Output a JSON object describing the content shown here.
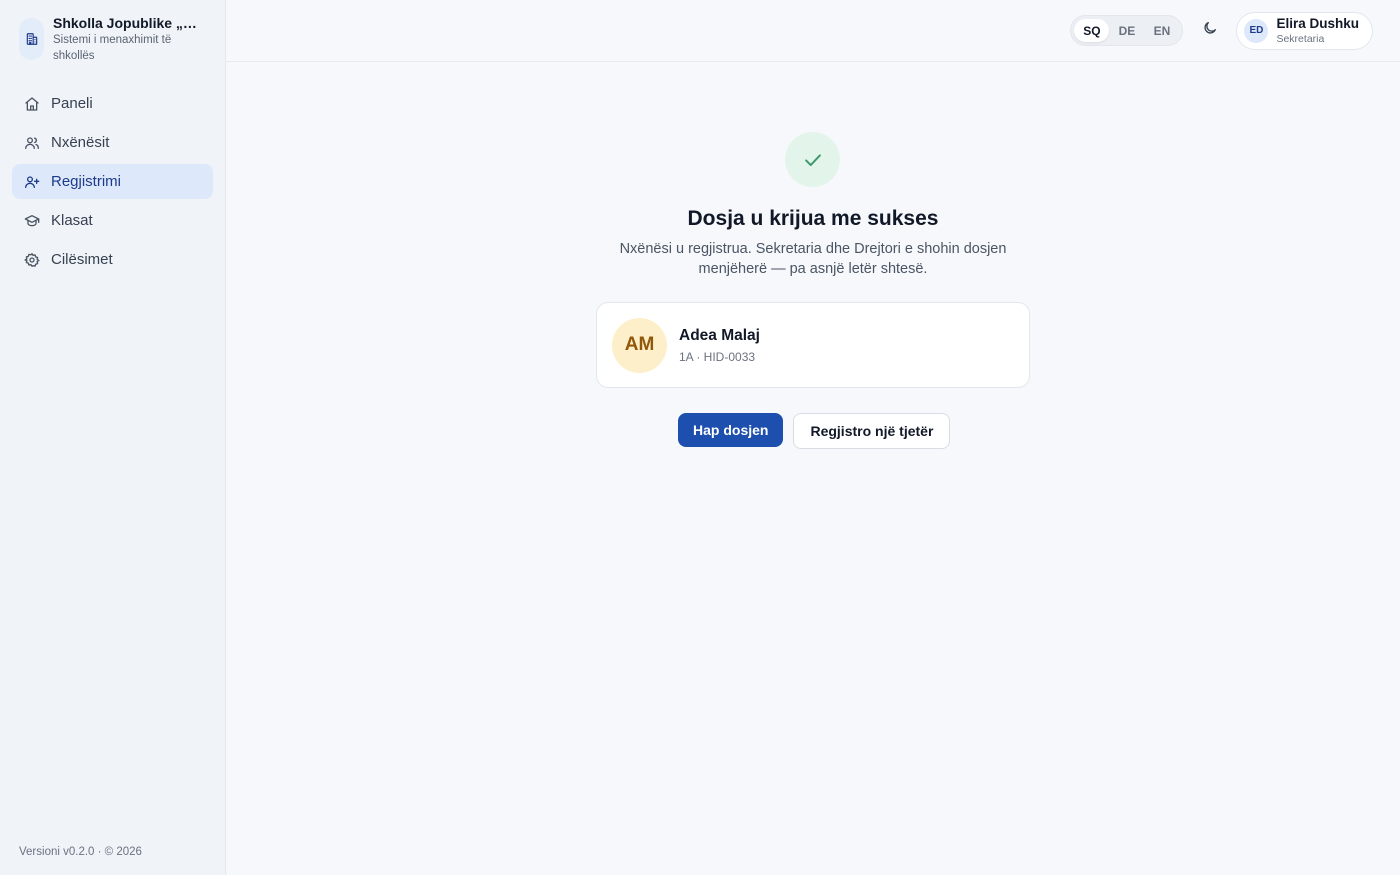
{
  "sidebar": {
    "brand_title": "Shkolla Jopublike „Hasan Prishtina“",
    "brand_subtitle": "Sistemi i menaxhimit të shkollës",
    "items": [
      {
        "label": "Paneli",
        "icon": "home-icon"
      },
      {
        "label": "Nxënësit",
        "icon": "users-icon"
      },
      {
        "label": "Regjistrimi",
        "icon": "user-plus-icon",
        "active": true
      },
      {
        "label": "Klasat",
        "icon": "graduation-cap-icon"
      },
      {
        "label": "Cilësimet",
        "icon": "gear-icon"
      }
    ],
    "version": "Versioni v0.2.0 · © 2026"
  },
  "topbar": {
    "languages": [
      "SQ",
      "DE",
      "EN"
    ],
    "active_language": "SQ",
    "theme_icon": "moon-icon",
    "user": {
      "initials": "ED",
      "name": "Elira Dushku",
      "role": "Sekretaria"
    }
  },
  "success": {
    "icon": "check-icon",
    "title": "Dosja u krijua me sukses",
    "description": "Nxënësi u regjistrua. Sekretaria dhe Drejtori e shohin dosjen menjëherë — pa asnjë letër shtesë.",
    "student": {
      "initials": "AM",
      "name": "Adea Malaj",
      "meta": "1A · HID-0033"
    },
    "primary_action": "Hap dosjen",
    "secondary_action": "Regjistro një tjetër"
  },
  "colors": {
    "primary": "#1d4fae",
    "active_nav_bg": "#dde9fb",
    "success_bg": "#e3f5ea",
    "success_check": "#3f9a6b",
    "student_avatar_bg": "#fdefc9"
  }
}
